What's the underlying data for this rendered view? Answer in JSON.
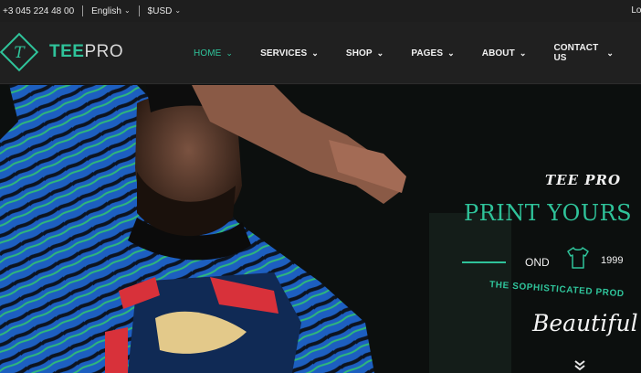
{
  "topbar": {
    "phone": "+3 045 224 48 00",
    "language": "English",
    "currency": "$USD",
    "login": "Log"
  },
  "header": {
    "logo_letter": "T",
    "logo_word_a": "TEE",
    "logo_word_b": "PRO",
    "nav": [
      {
        "label": "HOME",
        "active": true
      },
      {
        "label": "SERVICES",
        "active": false
      },
      {
        "label": "SHOP",
        "active": false
      },
      {
        "label": "PAGES",
        "active": false
      },
      {
        "label": "ABOUT",
        "active": false
      },
      {
        "label": "CONTACT US",
        "active": false
      }
    ]
  },
  "hero": {
    "brand": "TEE PRO",
    "headline": "PRINT YOURS",
    "est_prefix": "OND",
    "year": "1999",
    "tagline": "THE SOPHISTICATED PROD",
    "script": "Beautiful"
  },
  "colors": {
    "accent": "#2fc39a",
    "topbar_bg": "#1e1e1e",
    "header_bg": "#202020"
  }
}
